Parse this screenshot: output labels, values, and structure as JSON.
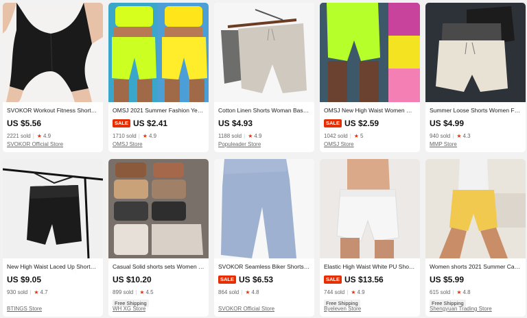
{
  "products": [
    {
      "title": "SVOKOR Workout Fitness Shorts S...",
      "sale": false,
      "price": "US $5.56",
      "sold": "2221 sold",
      "rating": "4.9",
      "free_shipping": "",
      "store": "SVOKOR Official Store"
    },
    {
      "title": "OMSJ 2021 Summer Fashion Yello...",
      "sale": true,
      "sale_label": "SALE",
      "price": "US $2.41",
      "sold": "1710 sold",
      "rating": "4.9",
      "free_shipping": "",
      "store": "OMSJ Store"
    },
    {
      "title": "Cotton Linen Shorts Woman Basic ...",
      "sale": false,
      "price": "US $4.93",
      "sold": "1188 sold",
      "rating": "4.9",
      "free_shipping": "",
      "store": "Populeader Store"
    },
    {
      "title": "OMSJ New High Waist Women Sex...",
      "sale": true,
      "sale_label": "SALE",
      "price": "US $2.59",
      "sold": "1042 sold",
      "rating": "5",
      "free_shipping": "",
      "store": "OMSJ Store"
    },
    {
      "title": "Summer Loose Shorts Women Fas...",
      "sale": false,
      "price": "US $4.99",
      "sold": "940 sold",
      "rating": "4.3",
      "free_shipping": "",
      "store": "MMP Store"
    },
    {
      "title": "New High Waist Laced Up Shorts Fl...",
      "sale": false,
      "price": "US $9.05",
      "sold": "930 sold",
      "rating": "4.7",
      "free_shipping": "",
      "store": "BTINGS Store"
    },
    {
      "title": "Casual Solid shorts sets Women 2...",
      "sale": false,
      "price": "US $10.20",
      "sold": "899 sold",
      "rating": "4.5",
      "free_shipping": "Free Shipping",
      "store": "WH XG Store"
    },
    {
      "title": "SVOKOR Seamless Biker Shorts W...",
      "sale": true,
      "sale_label": "SALE",
      "price": "US $6.53",
      "sold": "864 sold",
      "rating": "4.8",
      "free_shipping": "",
      "store": "SVOKOR Official Store"
    },
    {
      "title": "Elastic High Waist White PU Shorts...",
      "sale": true,
      "sale_label": "SALE",
      "price": "US $13.56",
      "sold": "744 sold",
      "rating": "4.9",
      "free_shipping": "Free Shipping",
      "store": "Byeleven Store"
    },
    {
      "title": "Women shorts 2021 Summer Casu...",
      "sale": false,
      "price": "US $5.99",
      "sold": "615 sold",
      "rating": "4.8",
      "free_shipping": "Free Shipping",
      "store": "Shengyuan Trading Store"
    }
  ],
  "icons": {
    "rating": "star-icon"
  },
  "colors": {
    "sale": "#e62e04",
    "star": "#e62e04",
    "background": "#f2f2f2"
  }
}
